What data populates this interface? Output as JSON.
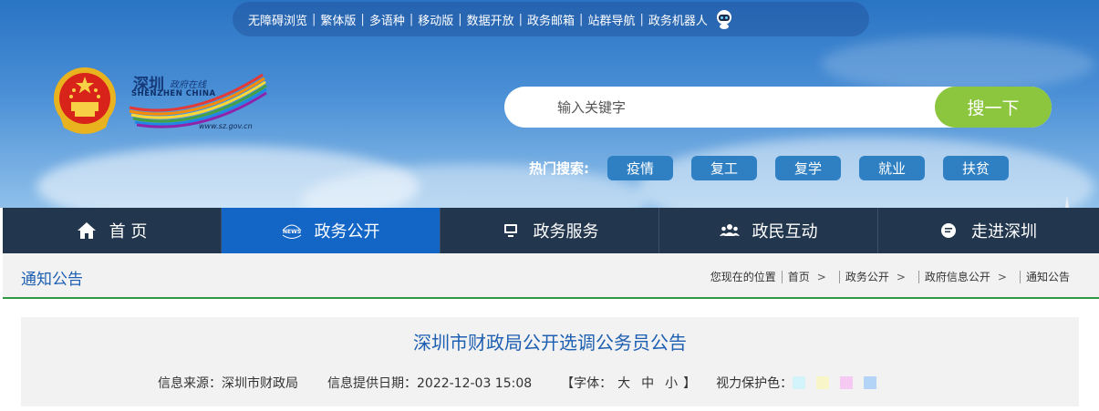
{
  "topbar": {
    "links": [
      "无障碍浏览",
      "繁体版",
      "多语种",
      "移动版",
      "数据开放",
      "政务邮箱",
      "站群导航",
      "政务机器人"
    ]
  },
  "logo": {
    "cn": "深圳",
    "cn_small": "政府在线",
    "en": "SHENZHEN CHINA",
    "url": "www.sz.gov.cn"
  },
  "search": {
    "placeholder": "输入关键字",
    "button_label": "搜一下"
  },
  "hot_search": {
    "label": "热门搜索:",
    "tags": [
      "疫情",
      "复工",
      "复学",
      "就业",
      "扶贫"
    ]
  },
  "nav": {
    "items": [
      {
        "label": "首 页",
        "icon": "home-icon",
        "active": false
      },
      {
        "label": "政务公开",
        "icon": "news-icon",
        "active": true
      },
      {
        "label": "政务服务",
        "icon": "monitor-icon",
        "active": false
      },
      {
        "label": "政民互动",
        "icon": "people-icon",
        "active": false
      },
      {
        "label": "走进深圳",
        "icon": "chat-icon",
        "active": false
      }
    ]
  },
  "section": {
    "title": "通知公告"
  },
  "breadcrumb": {
    "prefix": "您现在的位置",
    "items": [
      "首页",
      "政务公开",
      "政府信息公开",
      "通知公告"
    ],
    "separator": ">"
  },
  "article": {
    "title": "深圳市财政局公开选调公务员公告",
    "source": "信息来源：深圳市财政局",
    "date": "信息提供日期：2022-12-03 15:08",
    "font_label_open": "【字体：",
    "font_sizes": [
      "大",
      "中",
      "小"
    ],
    "font_label_close": "】",
    "eye_label": "视力保护色：",
    "eye_colors": [
      "#d4f4fb",
      "#f8f6c8",
      "#f6c9f3",
      "#b4d4f7"
    ]
  }
}
